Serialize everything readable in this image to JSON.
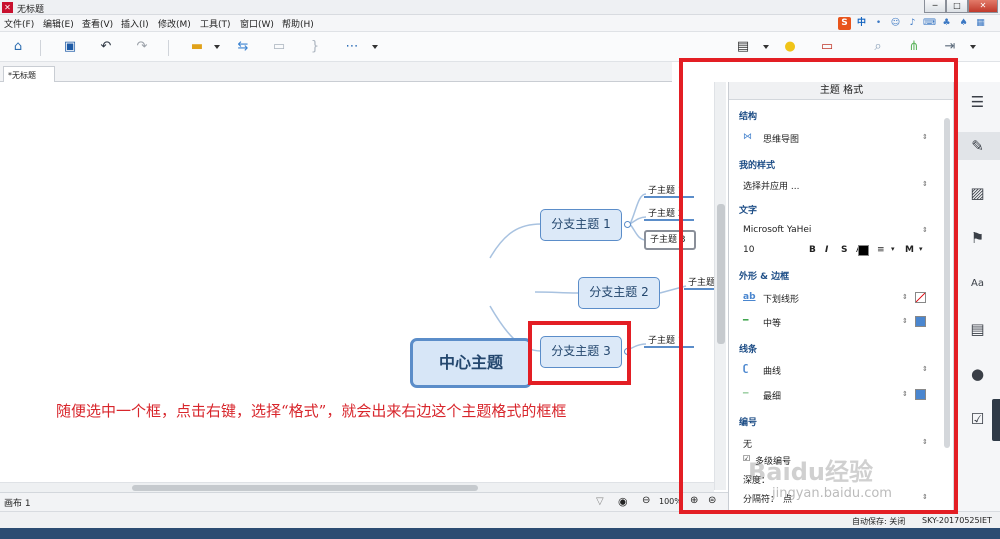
{
  "window": {
    "title": "无标题",
    "min": "─",
    "max": "□",
    "close": "✕"
  },
  "menu": [
    "文件(F)",
    "编辑(E)",
    "查看(V)",
    "插入(I)",
    "修改(M)",
    "工具(T)",
    "窗口(W)",
    "帮助(H)"
  ],
  "ime": {
    "logo": "S",
    "mode": "中"
  },
  "doc_tab": "*无标题",
  "mindmap": {
    "central": "中心主题",
    "branches": [
      "分支主题 1",
      "分支主题 2",
      "分支主题 3"
    ],
    "subs_b1": [
      "子主题 1",
      "子主题 2",
      "子主题 3"
    ],
    "sub_b2": "子主题",
    "sub_b3": "子主题 1"
  },
  "annotation": "随便选中一个框，点击右键，选择“格式”，就会出来右边这个主题格式的框框",
  "status": {
    "sheet": "画布 1",
    "zoom": "100%",
    "autosave": "自动保存: 关闭",
    "computer": "SKY-20170525IET"
  },
  "panel": {
    "title": "主题 格式",
    "structure_label": "结构",
    "structure_value": "思维导图",
    "mystyle_label": "我的样式",
    "mystyle_value": "选择并应用 ...",
    "text_label": "文字",
    "font_value": "Microsoft YaHei",
    "font_size": "10",
    "bold": "B",
    "italic": "I",
    "strike": "S",
    "case": "Aa",
    "align": "M",
    "shape_label": "外形 & 边框",
    "shape_value": "下划线形",
    "border_value": "中等",
    "line_label": "线条",
    "line_value": "曲线",
    "line_width": "最细",
    "number_label": "编号",
    "number_value": "无",
    "multi_level": "多级编号",
    "depth_label": "深度：",
    "separator_label": "分隔符：",
    "separator_value": "点",
    "colors": {
      "accent": "#4a86cf",
      "text": "#000000",
      "border_none": "#ffffff"
    }
  },
  "watermark": {
    "main": "Baidu经验",
    "url": "jingyan.baidu.com"
  },
  "colors": {
    "red_annotation": "#d8262c",
    "node_border": "#5b8dc9",
    "node_fill": "#dce9f8"
  }
}
